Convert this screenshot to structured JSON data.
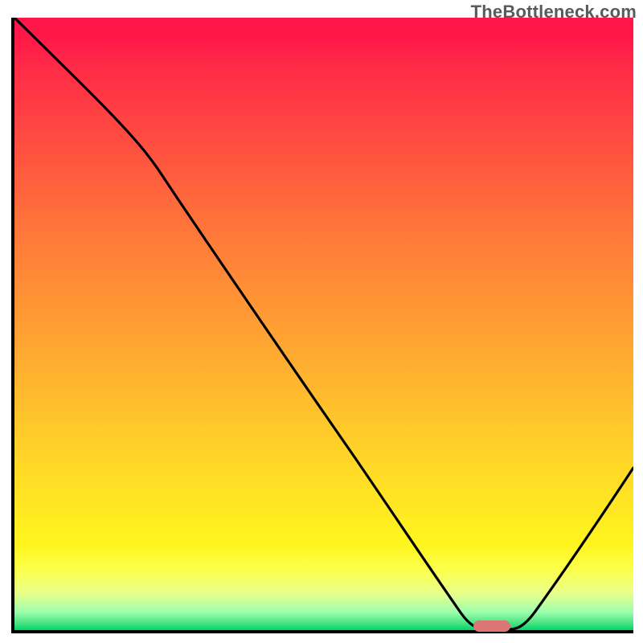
{
  "watermark": "TheBottleneck.com",
  "chart_data": {
    "type": "line",
    "title": "",
    "xlabel": "",
    "ylabel": "",
    "xlim": [
      0,
      100
    ],
    "ylim": [
      0,
      100
    ],
    "grid": false,
    "legend": false,
    "series": [
      {
        "name": "bottleneck-curve",
        "x": [
          0,
          10,
          20,
          24,
          40,
          55,
          65,
          72,
          76,
          80,
          86,
          92,
          100
        ],
        "y": [
          100,
          90,
          80,
          74,
          50,
          28,
          13,
          2,
          0,
          0,
          8,
          18,
          30
        ]
      }
    ],
    "marker": {
      "name": "optimal-range",
      "x_start": 74,
      "x_end": 80,
      "y": 0,
      "color": "#dc7576"
    },
    "background_gradient": {
      "top_color": "#ff1749",
      "mid_color": "#ffc72b",
      "bottom_color": "#00d36a"
    }
  }
}
